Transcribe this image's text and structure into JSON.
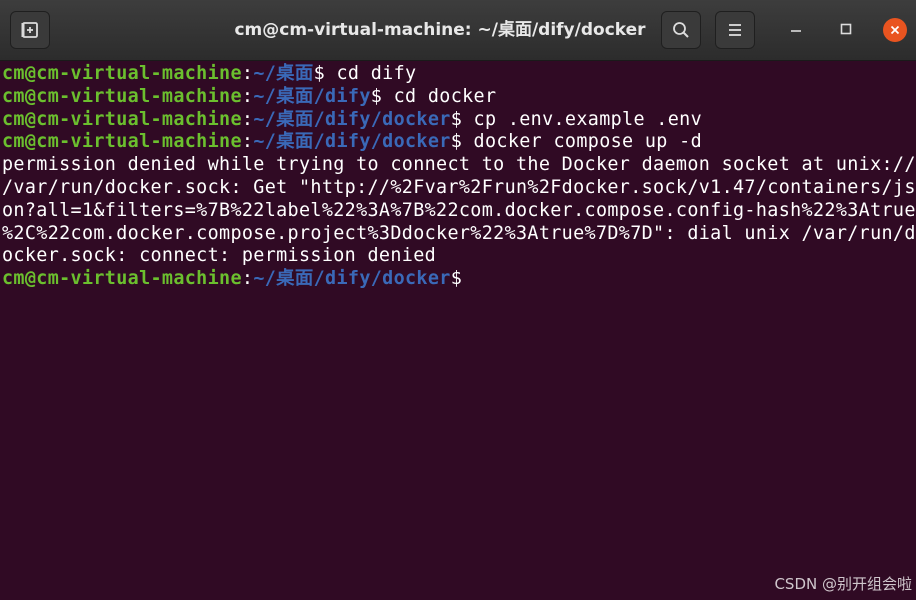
{
  "window": {
    "title": "cm@cm-virtual-machine: ~/桌面/dify/docker"
  },
  "titlebar": {
    "new_tab_icon": "new-tab-icon",
    "search_icon": "search-icon",
    "menu_icon": "hamburger-menu-icon",
    "minimize_icon": "minimize-icon",
    "maximize_icon": "maximize-icon",
    "close_icon": "close-icon"
  },
  "colors": {
    "terminal_bg": "#300a24",
    "prompt_user": "#6bbf2e",
    "prompt_path": "#3a69b8",
    "close_button": "#e95420"
  },
  "terminal": {
    "lines": [
      {
        "user": "cm@cm-virtual-machine",
        "sep": ":",
        "path": "~/桌面",
        "cmd": "$ cd dify"
      },
      {
        "user": "cm@cm-virtual-machine",
        "sep": ":",
        "path": "~/桌面/dify",
        "cmd": "$ cd docker"
      },
      {
        "user": "cm@cm-virtual-machine",
        "sep": ":",
        "path": "~/桌面/dify/docker",
        "cmd": "$ cp .env.example .env"
      },
      {
        "user": "cm@cm-virtual-machine",
        "sep": ":",
        "path": "~/桌面/dify/docker",
        "cmd": "$ docker compose up -d"
      }
    ],
    "output": [
      "permission denied while trying to connect to the Docker daemon socket at unix://",
      "/var/run/docker.sock: Get \"http://%2Fvar%2Frun%2Fdocker.sock/v1.47/containers/js",
      "on?all=1&filters=%7B%22label%22%3A%7B%22com.docker.compose.config-hash%22%3Atrue",
      "%2C%22com.docker.compose.project%3Ddocker%22%3Atrue%7D%7D\": dial unix /var/run/d",
      "ocker.sock: connect: permission denied"
    ],
    "final_prompt": {
      "user": "cm@cm-virtual-machine",
      "sep": ":",
      "path": "~/桌面/dify/docker",
      "cmd": "$"
    }
  },
  "watermark": "CSDN @别开组会啦"
}
